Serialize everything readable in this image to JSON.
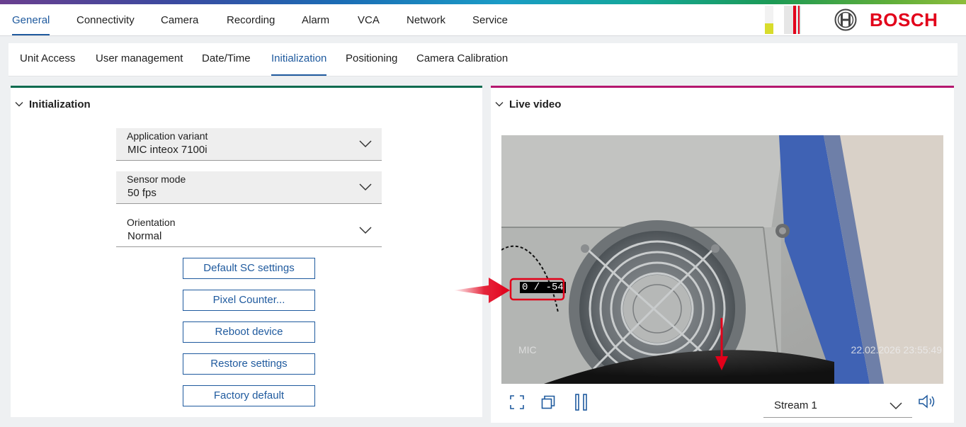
{
  "main_nav": {
    "tabs": [
      {
        "label": "General",
        "active": true
      },
      {
        "label": "Connectivity"
      },
      {
        "label": "Camera"
      },
      {
        "label": "Recording"
      },
      {
        "label": "Alarm"
      },
      {
        "label": "VCA"
      },
      {
        "label": "Network"
      },
      {
        "label": "Service"
      }
    ]
  },
  "brand": {
    "name": "BOSCH",
    "color": "#e2001a",
    "logo_icon": "bosch-armature-icon"
  },
  "sub_nav": {
    "tabs": [
      {
        "label": "Unit Access"
      },
      {
        "label": "User management"
      },
      {
        "label": "Date/Time"
      },
      {
        "label": "Initialization",
        "active": true
      },
      {
        "label": "Positioning"
      },
      {
        "label": "Camera Calibration"
      }
    ]
  },
  "initialization": {
    "title": "Initialization",
    "application_variant": {
      "label": "Application variant",
      "value": "MIC inteox 7100i"
    },
    "sensor_mode": {
      "label": "Sensor mode",
      "value": "50 fps"
    },
    "orientation": {
      "label": "Orientation",
      "value": "Normal"
    },
    "buttons": {
      "default_sc": "Default SC settings",
      "pixel_counter": "Pixel Counter...",
      "reboot": "Reboot device",
      "restore": "Restore settings",
      "factory": "Factory default"
    }
  },
  "live_video": {
    "title": "Live video",
    "overlay_coords": "0 / -54",
    "overlay_name": "MIC",
    "overlay_timestamp": "22.02.2026 23:55:49",
    "stream": {
      "value": "Stream 1"
    }
  },
  "colors": {
    "accent": "#1f5a9e",
    "left_panel": "#0b6b4f",
    "right_panel": "#b5176f",
    "annotation": "#e2001a"
  }
}
